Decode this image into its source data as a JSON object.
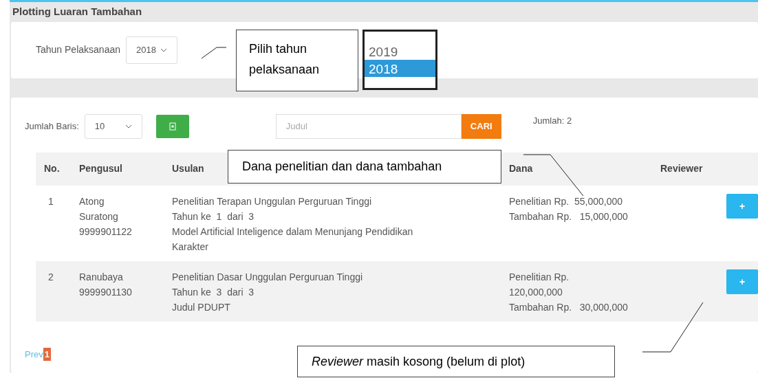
{
  "panel": {
    "title": "Plotting Luaran Tambahan",
    "year_label": "Tahun Pelaksanaan",
    "year_value": "2018"
  },
  "toolbar": {
    "rows_label": "Jumlah Baris:",
    "rows_value": "10",
    "search": {
      "placeholder": "Judul"
    },
    "search_button": "CARI",
    "total": "Jumlah: 2"
  },
  "table": {
    "columns": [
      "No.",
      "Pengusul",
      "Usulan",
      "Dana",
      "Reviewer"
    ],
    "rows": [
      {
        "no": "1",
        "pengusul": [
          "Atong",
          "Suratong",
          "9999901122"
        ],
        "usulan": [
          "Penelitian Terapan Unggulan Perguruan Tinggi",
          "Tahun ke  1  dari  3",
          "Model Artificial Inteligence dalam Menunjang Pendidikan Karakter"
        ],
        "dana": [
          "Penelitian Rp.  55,000,000",
          "Tambahan Rp.   15,000,000"
        ],
        "button": "+"
      },
      {
        "no": "2",
        "pengusul": [
          "Ranubaya",
          "9999901130"
        ],
        "usulan": [
          "Penelitian Dasar Unggulan Perguruan Tinggi",
          "Tahun ke  3  dari  3",
          "Judul PDUPT"
        ],
        "dana": [
          "Penelitian Rp.",
          "120,000,000",
          "Tambahan Rp.   30,000,000"
        ],
        "button": "+"
      }
    ]
  },
  "pagination": {
    "prev": "Prev",
    "pages": [
      {
        "label": "1",
        "selected": true
      }
    ]
  },
  "year_dropdown": [
    {
      "label": "2019",
      "selected": false
    },
    {
      "label": "2018",
      "selected": true
    }
  ],
  "callouts": [
    "Pilih tahun pelaksanaan",
    "Dana penelitian dan dana tambahan",
    "*Reviewer* masih kosong (belum di plot)"
  ]
}
